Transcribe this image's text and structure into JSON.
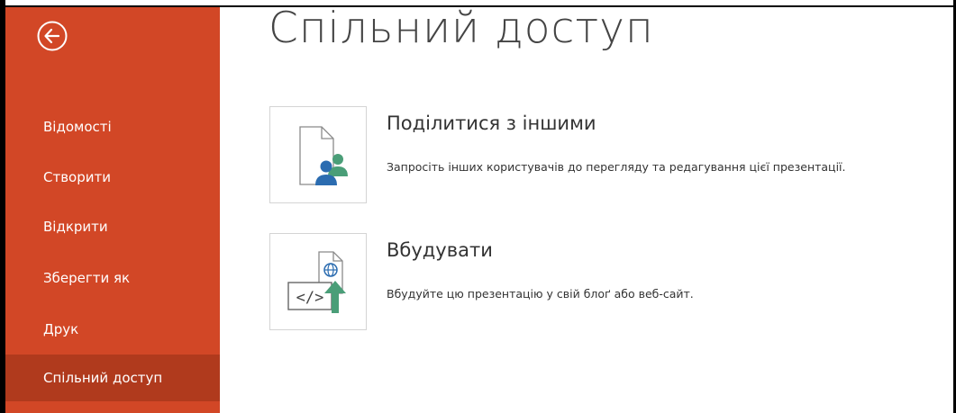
{
  "sidebar": {
    "items": [
      {
        "label": "Відомості"
      },
      {
        "label": "Створити"
      },
      {
        "label": "Відкрити"
      },
      {
        "label": "Зберегти як"
      },
      {
        "label": "Друк"
      },
      {
        "label": "Спільний доступ",
        "active": true
      }
    ]
  },
  "main": {
    "title": "Спільний доступ",
    "options": [
      {
        "title": "Поділитися з іншими",
        "description": "Запросіть інших користувачів до перегляду та редагування цієї презентації.",
        "icon": "share-people-icon"
      },
      {
        "title": "Вбудувати",
        "description": "Вбудуйте цю презентацію у свій блоґ або веб-сайт.",
        "icon": "embed-code-icon"
      }
    ]
  },
  "colors": {
    "accent": "#d24726",
    "accent_active": "#b03a1d",
    "person_blue": "#2b6cb0",
    "person_green": "#4a9e78"
  }
}
